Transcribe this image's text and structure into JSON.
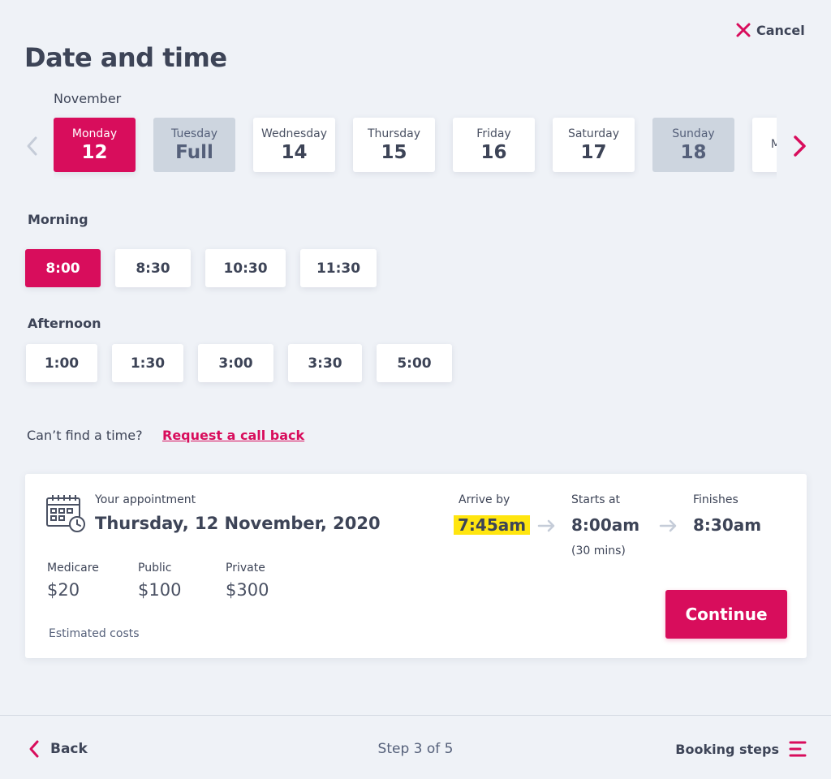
{
  "header": {
    "cancel_label": "Cancel",
    "title": "Date and time"
  },
  "calendar": {
    "month": "November",
    "days": [
      {
        "name": "Monday",
        "value": "12",
        "state": "selected"
      },
      {
        "name": "Tuesday",
        "value": "Full",
        "state": "unavailable"
      },
      {
        "name": "Wednesday",
        "value": "14",
        "state": "available"
      },
      {
        "name": "Thursday",
        "value": "15",
        "state": "available"
      },
      {
        "name": "Friday",
        "value": "16",
        "state": "available"
      },
      {
        "name": "Saturday",
        "value": "17",
        "state": "available"
      },
      {
        "name": "Sunday",
        "value": "18",
        "state": "unavailable"
      },
      {
        "name": "Monday",
        "value": "",
        "state": "available"
      }
    ]
  },
  "morning": {
    "label": "Morning",
    "slots": [
      {
        "time": "8:00",
        "selected": true
      },
      {
        "time": "8:30",
        "selected": false
      },
      {
        "time": "10:30",
        "selected": false
      },
      {
        "time": "11:30",
        "selected": false
      }
    ]
  },
  "afternoon": {
    "label": "Afternoon",
    "slots": [
      {
        "time": "1:00",
        "selected": false
      },
      {
        "time": "1:30",
        "selected": false
      },
      {
        "time": "3:00",
        "selected": false
      },
      {
        "time": "3:30",
        "selected": false
      },
      {
        "time": "5:00",
        "selected": false
      }
    ]
  },
  "help": {
    "prompt": "Can’t find a time?",
    "link": "Request a call back"
  },
  "summary": {
    "appointment_label": "Your appointment",
    "appointment_date": "Thursday, 12 November, 2020",
    "arrive_label": "Arrive by",
    "arrive_time": "7:45am",
    "starts_label": "Starts at",
    "starts_time": "8:00am",
    "duration": "(30 mins)",
    "finishes_label": "Finishes",
    "finishes_time": "8:30am",
    "costs": [
      {
        "label": "Medicare",
        "amount": "$20"
      },
      {
        "label": "Public",
        "amount": "$100"
      },
      {
        "label": "Private",
        "amount": "$300"
      }
    ],
    "costs_note": "Estimated costs",
    "continue_label": "Continue"
  },
  "footer": {
    "back_label": "Back",
    "step_text": "Step 3 of 5",
    "steps_label": "Booking steps"
  },
  "colors": {
    "accent": "#d80d5c",
    "background": "#eff2f7",
    "unavailable": "#cdd5df",
    "highlight": "#ffe50f",
    "text": "#3d4457"
  },
  "icons": [
    "close-icon",
    "chevron-left-icon",
    "chevron-right-icon",
    "calendar-clock-icon",
    "arrow-right-icon",
    "menu-lines-icon"
  ]
}
